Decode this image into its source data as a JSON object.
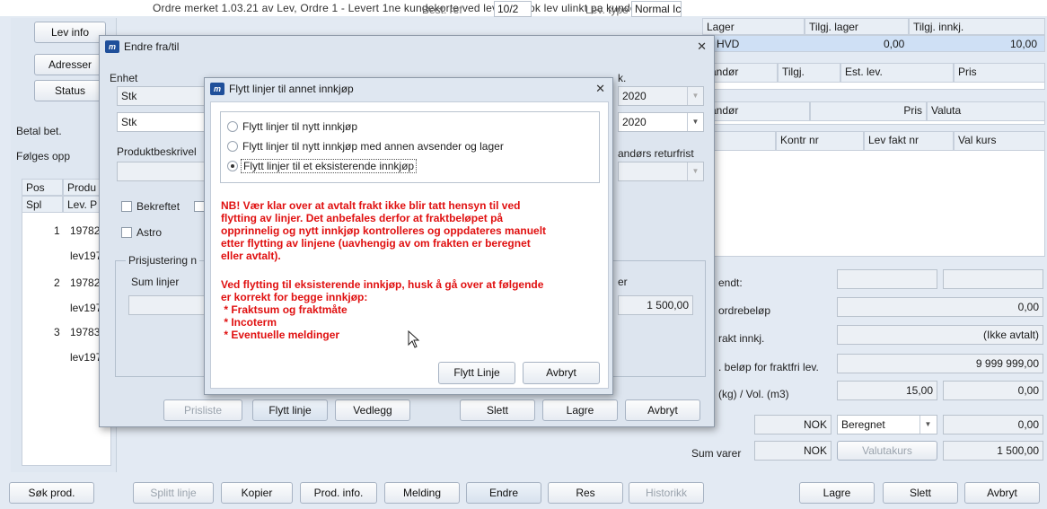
{
  "top": {
    "strip_text": "Ordre merket 1.03.21 av Lev, Ordre 1 - Levert 1ne kundekorte ved levering, ok lev ulinkt pa kunde nr, ne"
  },
  "left": {
    "lev_info": "Lev info",
    "adresser": "Adresser",
    "status": "Status",
    "betal_bet": "Betal bet.",
    "folges_opp": "Følges opp",
    "grid_headers": [
      "Pos",
      "Produ",
      "Spl",
      "Lev. P"
    ],
    "rows": [
      {
        "pos": "1",
        "prod": "19782",
        "lev": "lev197"
      },
      {
        "pos": "2",
        "prod": "19782",
        "lev": "lev197"
      },
      {
        "pos": "3",
        "prod": "19783",
        "lev": "lev197"
      }
    ]
  },
  "header_fields": {
    "best_ref_label": "Best. ref",
    "best_ref_value": "10/2",
    "lev_type_label": "Lev. type",
    "lev_type_value": "Normal Ic"
  },
  "right": {
    "lager_headers": [
      "Lager",
      "Tilgj. lager",
      "Tilgj. innkj."
    ],
    "lager_row": {
      "name": "HVD",
      "tilgj_lager": "0,00",
      "tilgj_innkj": "10,00"
    },
    "lev_headers": [
      "randør",
      "Tilgj.",
      "Est. lev.",
      "Pris"
    ],
    "lev2_headers": [
      "randør",
      "Pris",
      "Valuta"
    ],
    "faktura_headers": [
      "Kontr nr",
      "Lev fakt nr",
      "Val kurs"
    ],
    "sendt_label": "endt:",
    "ordrebelop_label": "ordrebeløp",
    "ordrebelop_value": "0,00",
    "frakt_innkj_label": "rakt innkj.",
    "frakt_innkj_value": "(Ikke avtalt)",
    "fraktfri_label": ". beløp for fraktfri lev.",
    "fraktfri_value": "9 999 999,00",
    "kg_label": "(kg) / Vol. (m3)",
    "kg_value": "15,00",
    "vol_value": "0,00",
    "nok1": "NOK",
    "beregnet": "Beregnet",
    "frakt_value": "0,00",
    "sum_varer_label": "Sum varer",
    "nok2": "NOK",
    "valutakurs": "Valutakurs",
    "sum_varer_value": "1 500,00"
  },
  "bottom_buttons": [
    "Søk prod.",
    "Splitt linje",
    "Kopier",
    "Prod. info.",
    "Melding",
    "Endre",
    "Res",
    "Historikk",
    "Lagre",
    "Slett",
    "Avbryt"
  ],
  "endre_dialog": {
    "title": "Endre fra/til",
    "enhet_label": "Enhet",
    "enhet_value1": "Stk",
    "enhet_value2": "Stk",
    "produktbeskrivelse_label": "Produktbeskrivel",
    "bekreftet_label": "Bekreftet",
    "astro_label": "Astro",
    "prisjustering_label": "Prisjustering n",
    "sum_linjer_label": "Sum linjer",
    "right_label_k": "k.",
    "year1": "2020",
    "year2": "2020",
    "returfrist_label": "andørs returfrist",
    "er_label": "er",
    "sum_value": "1 500,00",
    "buttons": [
      "Prisliste",
      "Flytt linje",
      "Vedlegg",
      "Slett",
      "Lagre",
      "Avbryt"
    ]
  },
  "flytt_dialog": {
    "title": "Flytt linjer til annet innkjøp",
    "options": [
      "Flytt linjer til nytt innkjøp",
      "Flytt linjer til nytt innkjøp med annen avsender og lager",
      "Flytt linjer til et eksisterende innkjøp"
    ],
    "warning1": "NB! Vær klar over at avtalt frakt ikke blir tatt hensyn til ved\nflytting av linjer. Det anbefales derfor at fraktbeløpet på\nopprinnelig og nytt innkjøp kontrolleres og oppdateres manuelt\netter flytting av linjene (uavhengig av om frakten er beregnet\neller avtalt).",
    "warning2": "Ved flytting til eksisterende innkjøp, husk å gå over at følgende\ner korrekt for begge innkjøp:\n * Fraktsum og fraktmåte\n * Incoterm\n * Eventuelle meldinger",
    "ok": "Flytt Linje",
    "cancel": "Avbryt"
  }
}
